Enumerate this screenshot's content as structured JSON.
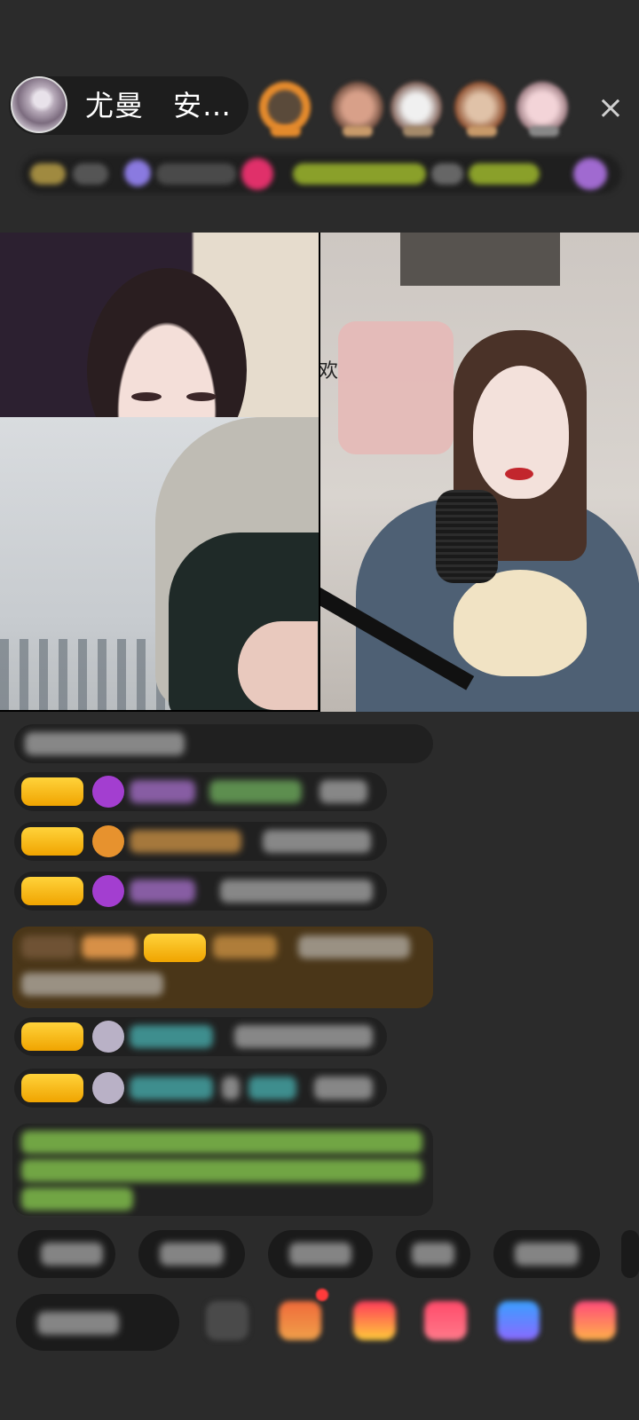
{
  "header": {
    "host_name": "尤曼　安…",
    "close_icon": "×"
  },
  "colors": {
    "background": "#2b2b2b",
    "badge_gold": "#f0a400",
    "gift_bubble": "#4a3618",
    "accent_red": "#ff3b3b"
  },
  "icons": {
    "close": "close-icon",
    "avatar": "user-avatar",
    "gift": "gift-icon"
  },
  "tiles": {
    "right_glyph": "欢"
  }
}
